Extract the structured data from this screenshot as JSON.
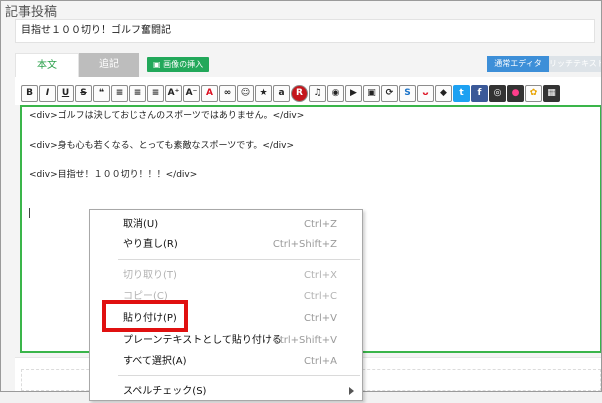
{
  "page": {
    "heading": "記事投稿"
  },
  "post": {
    "title": "目指せ１００切り！ゴルフ奮闘記"
  },
  "tabs": {
    "main": "本文",
    "extra": "追記"
  },
  "image_button": {
    "icon": "image-icon",
    "label": "画像の挿入"
  },
  "editor_modes": {
    "normal": "通常エディタ",
    "rich": "リッチテキスト"
  },
  "toolbar": {
    "items": [
      {
        "icon": "bold-icon",
        "glyph": "B"
      },
      {
        "icon": "italic-icon",
        "glyph": "I"
      },
      {
        "icon": "underline-icon",
        "glyph": "U"
      },
      {
        "icon": "strikethrough-icon",
        "glyph": "S"
      },
      {
        "icon": "quote-icon",
        "glyph": "❝"
      },
      {
        "icon": "align-left-icon",
        "glyph": "≡"
      },
      {
        "icon": "align-center-icon",
        "glyph": "≡"
      },
      {
        "icon": "align-right-icon",
        "glyph": "≡"
      },
      {
        "icon": "font-size-up-icon",
        "glyph": "A⁺"
      },
      {
        "icon": "font-size-down-icon",
        "glyph": "A⁻"
      },
      {
        "icon": "font-color-icon",
        "glyph": "A"
      },
      {
        "icon": "link-icon",
        "glyph": "∞"
      },
      {
        "icon": "emoji-icon",
        "glyph": "☺"
      },
      {
        "icon": "star-icon",
        "glyph": "★"
      },
      {
        "icon": "amazon-icon",
        "glyph": "a"
      },
      {
        "icon": "rakuten-icon",
        "glyph": "R"
      },
      {
        "icon": "music-icon",
        "glyph": "♫"
      },
      {
        "icon": "globe-icon",
        "glyph": "◉"
      },
      {
        "icon": "youtube-icon",
        "glyph": "▶"
      },
      {
        "icon": "niconico-icon",
        "glyph": "▣"
      },
      {
        "icon": "share-icon",
        "glyph": "⟳"
      },
      {
        "icon": "circle-s-icon",
        "glyph": "S"
      },
      {
        "icon": "smile-face-icon",
        "glyph": "ᴗ"
      },
      {
        "icon": "tag-icon",
        "glyph": "◆"
      },
      {
        "icon": "twitter-icon",
        "glyph": "t"
      },
      {
        "icon": "facebook-icon",
        "glyph": "f"
      },
      {
        "icon": "instagram-icon",
        "glyph": "◎"
      },
      {
        "icon": "flickr-icon",
        "glyph": "●"
      },
      {
        "icon": "photos-icon",
        "glyph": "✿"
      },
      {
        "icon": "table-icon",
        "glyph": "▦"
      }
    ]
  },
  "editor": {
    "lines": [
      "<div>ゴルフは決しておじさんのスポーツではありません。</div>",
      "<div>身も心も若くなる、とっても素敵なスポーツです。</div>",
      "<div>目指せ！１００切り！！！</div>"
    ]
  },
  "context_menu": {
    "undo": {
      "label": "取消(U)",
      "shortcut": "Ctrl+Z"
    },
    "redo": {
      "label": "やり直し(R)",
      "shortcut": "Ctrl+Shift+Z"
    },
    "cut": {
      "label": "切り取り(T)",
      "shortcut": "Ctrl+X"
    },
    "copy": {
      "label": "コピー(C)",
      "shortcut": "Ctrl+C"
    },
    "paste": {
      "label": "貼り付け(P)",
      "shortcut": "Ctrl+V"
    },
    "paste_plain": {
      "label": "プレーンテキストとして貼り付ける",
      "shortcut": "Ctrl+Shift+V"
    },
    "select_all": {
      "label": "すべて選択(A)",
      "shortcut": "Ctrl+A"
    },
    "spellcheck": {
      "label": "スペルチェック(S)"
    }
  },
  "colors": {
    "accent_green": "#3ab54a",
    "highlight_red": "#e01010",
    "mode_blue": "#3d8fd8"
  }
}
